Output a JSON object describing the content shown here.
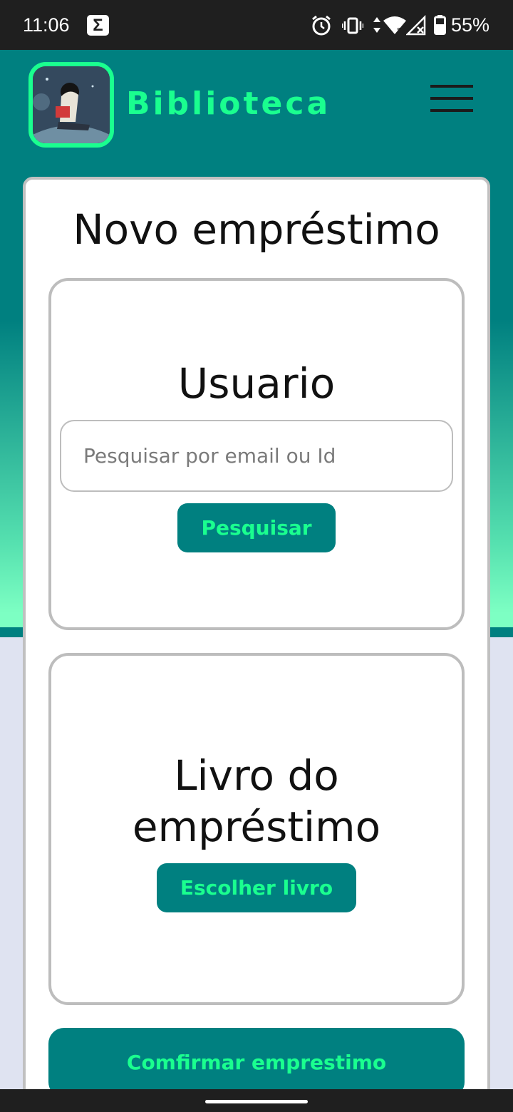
{
  "status_bar": {
    "time": "11:06",
    "notification_icon": "sigma-icon",
    "icons": [
      "alarm-icon",
      "vibrate-icon",
      "data-arrows-icon",
      "wifi-icon",
      "signal-icon",
      "battery-icon"
    ],
    "battery": "55%"
  },
  "header": {
    "brand": "Biblioteca",
    "logo": "reading-boy-logo",
    "menu_icon": "hamburger-menu-icon"
  },
  "page": {
    "title": "Novo empréstimo"
  },
  "user_section": {
    "title": "Usuario",
    "search_placeholder": "Pesquisar por email ou Id",
    "search_value": "",
    "search_button": "Pesquisar"
  },
  "book_section": {
    "title_line1": "Livro do",
    "title_line2": "empréstimo",
    "choose_button": "Escolher livro"
  },
  "confirm_button": "Comfirmar emprestimo",
  "colors": {
    "primary": "#008080",
    "accent": "#1aff8f",
    "gradient_end": "#7dffc3",
    "page_background": "#dfe3f1"
  }
}
